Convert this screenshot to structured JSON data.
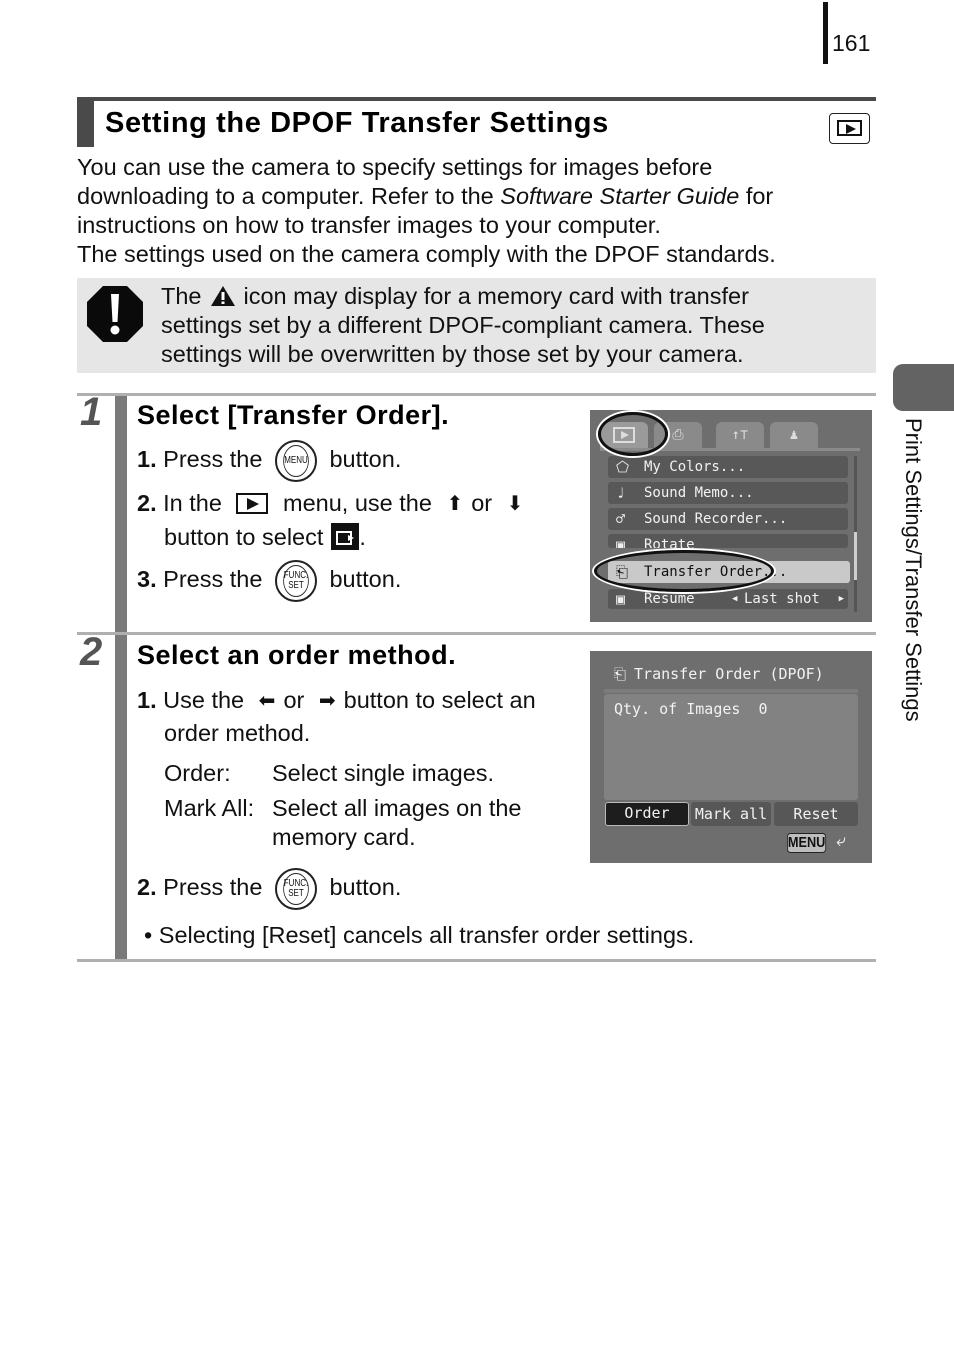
{
  "page": {
    "number": "161",
    "side_tab_label": "Print Settings/Transfer Settings"
  },
  "header": {
    "title": "Setting the DPOF Transfer Settings",
    "mode_icon": "playback-mode-icon"
  },
  "intro": {
    "line1": "You can use the camera to specify settings for images before",
    "line2_pre": "downloading to a computer. Refer to the ",
    "line2_em": "Software Starter Guide",
    "line2_post": " for",
    "line3": "instructions on how to transfer images to your computer.",
    "line4": "The settings used on the camera comply with the DPOF standards."
  },
  "caution": {
    "icon": "caution-octagon-icon",
    "pre": "The",
    "inline_icon": "warning-triangle-icon",
    "line1_post": "icon may display for a memory card with transfer",
    "line2": "settings set by a different DPOF-compliant camera. These",
    "line3": "settings will be overwritten by those set by your camera."
  },
  "steps": [
    {
      "number": "1",
      "title": "Select [Transfer Order].",
      "items": [
        {
          "n": "1.",
          "pre": "Press the",
          "button": "MENU",
          "post": "button."
        },
        {
          "n": "2.",
          "pre": "In the",
          "mid": "menu, use the",
          "up": "⬆",
          "or": "or",
          "down": "⬇",
          "line2": "button to select",
          "end": "."
        },
        {
          "n": "3.",
          "pre": "Press the",
          "button_top": "FUNC.",
          "button_bot": "SET",
          "post": "button."
        }
      ],
      "screen": {
        "tabs": [
          "playback-tab",
          "print-tab",
          "setup-tab",
          "my-camera-tab"
        ],
        "tab_glyphs": [
          "",
          "⎙",
          "↑⊤",
          "♟"
        ],
        "menu_items": [
          {
            "icon": "⬠",
            "label": "My Colors..."
          },
          {
            "icon": "♩",
            "label": "Sound Memo..."
          },
          {
            "icon": "♂",
            "label": "Sound Recorder..."
          },
          {
            "icon": "▣",
            "label": "Rotate"
          },
          {
            "icon": "⎗",
            "label": "Transfer Order...",
            "selected": true
          },
          {
            "icon": "▣",
            "label": "Resume",
            "value": "Last shot"
          }
        ]
      }
    },
    {
      "number": "2",
      "title": "Select an order method.",
      "items": [
        {
          "n": "1.",
          "pre": "Use the",
          "left": "⬅",
          "or": "or",
          "right": "➡",
          "post": "button to select an",
          "line2": "order method."
        },
        {
          "n": "2.",
          "pre": "Press the",
          "button_top": "FUNC.",
          "button_bot": "SET",
          "post": "button."
        }
      ],
      "definitions": [
        {
          "term": "Order:",
          "desc": "Select single images."
        },
        {
          "term": "Mark All:",
          "desc": "Select all images on the",
          "desc2": "memory card."
        }
      ],
      "note": "Selecting [Reset] cancels all transfer order settings.",
      "screen": {
        "title": "Transfer Order (DPOF)",
        "qty_label": "Qty. of Images",
        "qty_value": "0",
        "buttons": [
          "Order",
          "Mark all",
          "Reset"
        ],
        "active_button": "Order",
        "menu_key": "MENU",
        "return_glyph": "⤶"
      }
    }
  ]
}
